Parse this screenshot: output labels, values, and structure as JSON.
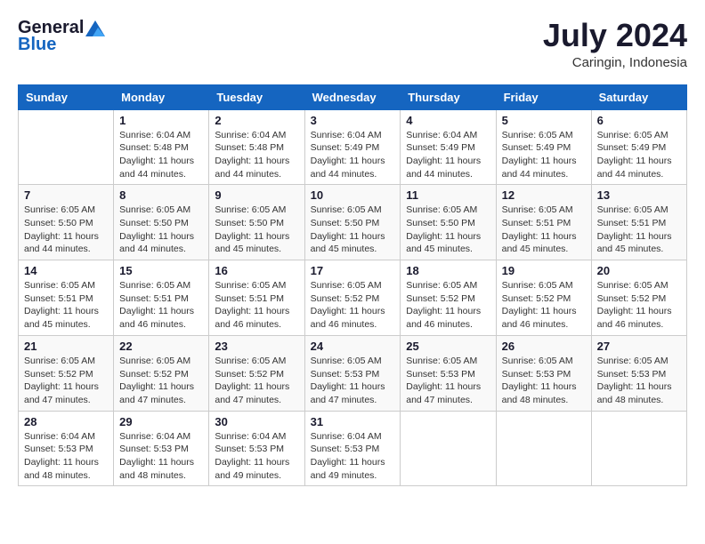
{
  "header": {
    "logo_general": "General",
    "logo_blue": "Blue",
    "month": "July 2024",
    "location": "Caringin, Indonesia"
  },
  "days_of_week": [
    "Sunday",
    "Monday",
    "Tuesday",
    "Wednesday",
    "Thursday",
    "Friday",
    "Saturday"
  ],
  "weeks": [
    [
      {
        "num": "",
        "sunrise": "",
        "sunset": "",
        "daylight": ""
      },
      {
        "num": "1",
        "sunrise": "Sunrise: 6:04 AM",
        "sunset": "Sunset: 5:48 PM",
        "daylight": "Daylight: 11 hours and 44 minutes."
      },
      {
        "num": "2",
        "sunrise": "Sunrise: 6:04 AM",
        "sunset": "Sunset: 5:48 PM",
        "daylight": "Daylight: 11 hours and 44 minutes."
      },
      {
        "num": "3",
        "sunrise": "Sunrise: 6:04 AM",
        "sunset": "Sunset: 5:49 PM",
        "daylight": "Daylight: 11 hours and 44 minutes."
      },
      {
        "num": "4",
        "sunrise": "Sunrise: 6:04 AM",
        "sunset": "Sunset: 5:49 PM",
        "daylight": "Daylight: 11 hours and 44 minutes."
      },
      {
        "num": "5",
        "sunrise": "Sunrise: 6:05 AM",
        "sunset": "Sunset: 5:49 PM",
        "daylight": "Daylight: 11 hours and 44 minutes."
      },
      {
        "num": "6",
        "sunrise": "Sunrise: 6:05 AM",
        "sunset": "Sunset: 5:49 PM",
        "daylight": "Daylight: 11 hours and 44 minutes."
      }
    ],
    [
      {
        "num": "7",
        "sunrise": "Sunrise: 6:05 AM",
        "sunset": "Sunset: 5:50 PM",
        "daylight": "Daylight: 11 hours and 44 minutes."
      },
      {
        "num": "8",
        "sunrise": "Sunrise: 6:05 AM",
        "sunset": "Sunset: 5:50 PM",
        "daylight": "Daylight: 11 hours and 44 minutes."
      },
      {
        "num": "9",
        "sunrise": "Sunrise: 6:05 AM",
        "sunset": "Sunset: 5:50 PM",
        "daylight": "Daylight: 11 hours and 45 minutes."
      },
      {
        "num": "10",
        "sunrise": "Sunrise: 6:05 AM",
        "sunset": "Sunset: 5:50 PM",
        "daylight": "Daylight: 11 hours and 45 minutes."
      },
      {
        "num": "11",
        "sunrise": "Sunrise: 6:05 AM",
        "sunset": "Sunset: 5:50 PM",
        "daylight": "Daylight: 11 hours and 45 minutes."
      },
      {
        "num": "12",
        "sunrise": "Sunrise: 6:05 AM",
        "sunset": "Sunset: 5:51 PM",
        "daylight": "Daylight: 11 hours and 45 minutes."
      },
      {
        "num": "13",
        "sunrise": "Sunrise: 6:05 AM",
        "sunset": "Sunset: 5:51 PM",
        "daylight": "Daylight: 11 hours and 45 minutes."
      }
    ],
    [
      {
        "num": "14",
        "sunrise": "Sunrise: 6:05 AM",
        "sunset": "Sunset: 5:51 PM",
        "daylight": "Daylight: 11 hours and 45 minutes."
      },
      {
        "num": "15",
        "sunrise": "Sunrise: 6:05 AM",
        "sunset": "Sunset: 5:51 PM",
        "daylight": "Daylight: 11 hours and 46 minutes."
      },
      {
        "num": "16",
        "sunrise": "Sunrise: 6:05 AM",
        "sunset": "Sunset: 5:51 PM",
        "daylight": "Daylight: 11 hours and 46 minutes."
      },
      {
        "num": "17",
        "sunrise": "Sunrise: 6:05 AM",
        "sunset": "Sunset: 5:52 PM",
        "daylight": "Daylight: 11 hours and 46 minutes."
      },
      {
        "num": "18",
        "sunrise": "Sunrise: 6:05 AM",
        "sunset": "Sunset: 5:52 PM",
        "daylight": "Daylight: 11 hours and 46 minutes."
      },
      {
        "num": "19",
        "sunrise": "Sunrise: 6:05 AM",
        "sunset": "Sunset: 5:52 PM",
        "daylight": "Daylight: 11 hours and 46 minutes."
      },
      {
        "num": "20",
        "sunrise": "Sunrise: 6:05 AM",
        "sunset": "Sunset: 5:52 PM",
        "daylight": "Daylight: 11 hours and 46 minutes."
      }
    ],
    [
      {
        "num": "21",
        "sunrise": "Sunrise: 6:05 AM",
        "sunset": "Sunset: 5:52 PM",
        "daylight": "Daylight: 11 hours and 47 minutes."
      },
      {
        "num": "22",
        "sunrise": "Sunrise: 6:05 AM",
        "sunset": "Sunset: 5:52 PM",
        "daylight": "Daylight: 11 hours and 47 minutes."
      },
      {
        "num": "23",
        "sunrise": "Sunrise: 6:05 AM",
        "sunset": "Sunset: 5:52 PM",
        "daylight": "Daylight: 11 hours and 47 minutes."
      },
      {
        "num": "24",
        "sunrise": "Sunrise: 6:05 AM",
        "sunset": "Sunset: 5:53 PM",
        "daylight": "Daylight: 11 hours and 47 minutes."
      },
      {
        "num": "25",
        "sunrise": "Sunrise: 6:05 AM",
        "sunset": "Sunset: 5:53 PM",
        "daylight": "Daylight: 11 hours and 47 minutes."
      },
      {
        "num": "26",
        "sunrise": "Sunrise: 6:05 AM",
        "sunset": "Sunset: 5:53 PM",
        "daylight": "Daylight: 11 hours and 48 minutes."
      },
      {
        "num": "27",
        "sunrise": "Sunrise: 6:05 AM",
        "sunset": "Sunset: 5:53 PM",
        "daylight": "Daylight: 11 hours and 48 minutes."
      }
    ],
    [
      {
        "num": "28",
        "sunrise": "Sunrise: 6:04 AM",
        "sunset": "Sunset: 5:53 PM",
        "daylight": "Daylight: 11 hours and 48 minutes."
      },
      {
        "num": "29",
        "sunrise": "Sunrise: 6:04 AM",
        "sunset": "Sunset: 5:53 PM",
        "daylight": "Daylight: 11 hours and 48 minutes."
      },
      {
        "num": "30",
        "sunrise": "Sunrise: 6:04 AM",
        "sunset": "Sunset: 5:53 PM",
        "daylight": "Daylight: 11 hours and 49 minutes."
      },
      {
        "num": "31",
        "sunrise": "Sunrise: 6:04 AM",
        "sunset": "Sunset: 5:53 PM",
        "daylight": "Daylight: 11 hours and 49 minutes."
      },
      {
        "num": "",
        "sunrise": "",
        "sunset": "",
        "daylight": ""
      },
      {
        "num": "",
        "sunrise": "",
        "sunset": "",
        "daylight": ""
      },
      {
        "num": "",
        "sunrise": "",
        "sunset": "",
        "daylight": ""
      }
    ]
  ]
}
